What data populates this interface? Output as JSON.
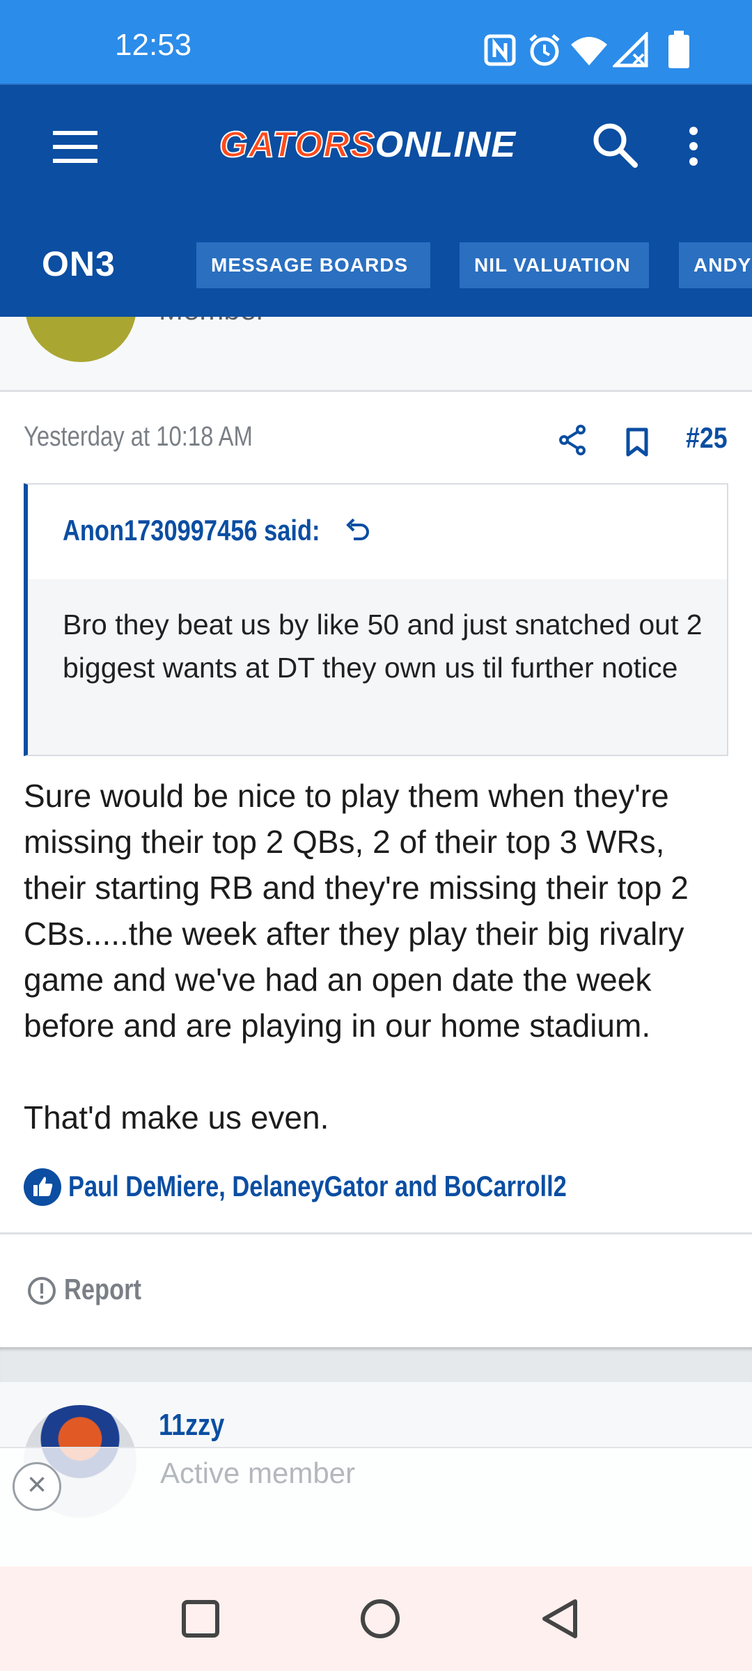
{
  "status_bar": {
    "time": "12:53",
    "icons": [
      "nfc-icon",
      "alarm-icon",
      "wifi-icon",
      "signal-icon",
      "battery-icon"
    ]
  },
  "header": {
    "logo_part1": "GATORS",
    "logo_part2": "ONLINE",
    "brand": "ON3",
    "nav": [
      "MESSAGE BOARDS",
      "NIL VALUATION",
      "ANDY"
    ],
    "colors": {
      "header_bg": "#0b4ea2",
      "status_bg": "#2b8cea",
      "logo_orange": "#ff4a1c"
    }
  },
  "previous_post": {
    "role_partial": "Member"
  },
  "post": {
    "date": "Yesterday at 10:18 AM",
    "number": "#25",
    "quote": {
      "author": "Anon1730997456 said:",
      "text": "Bro they beat us by like 50 and just snatched out 2 biggest wants at DT they own us til further notice"
    },
    "message": {
      "paragraph1": "Sure would be nice to play them when they're missing their top 2 QBs, 2 of their top 3 WRs, their starting RB and they're missing their top 2 CBs.....the week after they play their big rivalry game and we've had an open date the week before and are playing in our home stadium.",
      "paragraph2": "That'd make us even."
    },
    "reactions": "Paul DeMiere, DelaneyGator and BoCarroll2",
    "report_label": "Report"
  },
  "next_post": {
    "username": "11zzy",
    "role": "Active member"
  },
  "system_nav": [
    "recents-button",
    "home-button",
    "back-button"
  ]
}
